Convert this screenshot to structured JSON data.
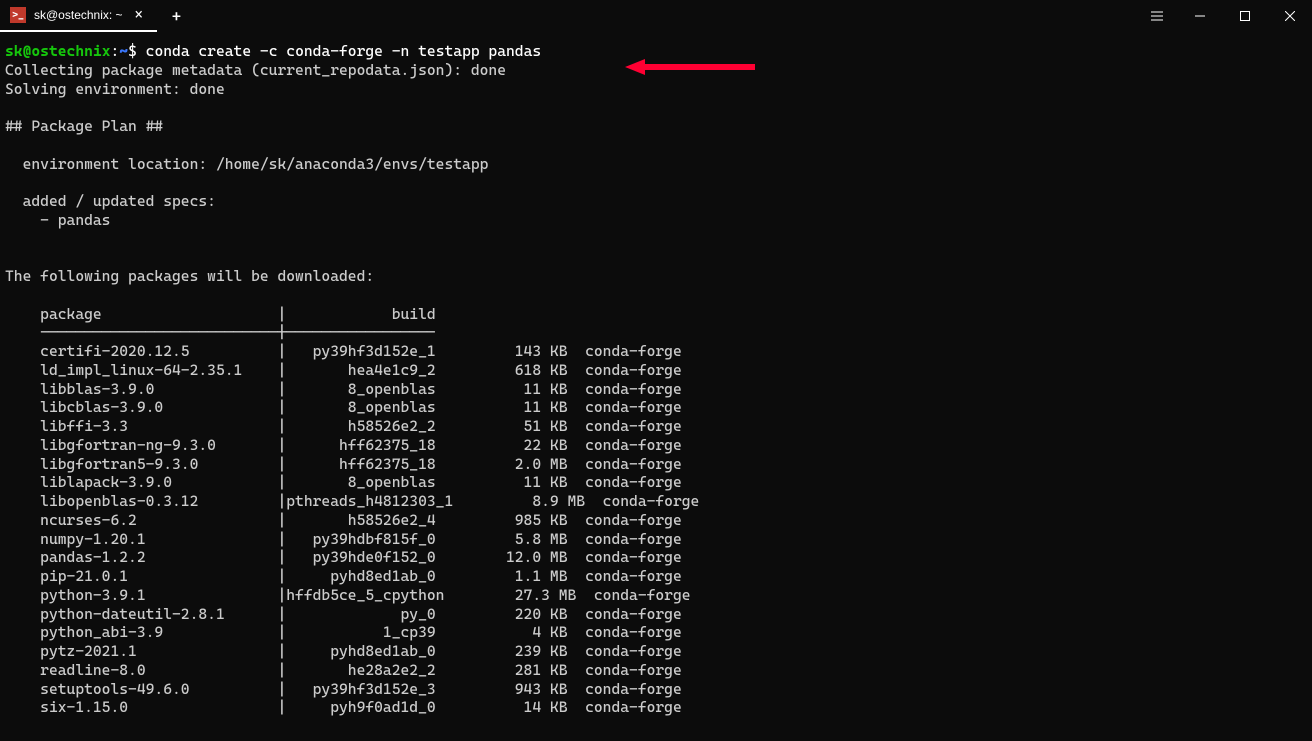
{
  "titlebar": {
    "tab_title": "sk@ostechnix: ~",
    "tab_icon_text": ">_"
  },
  "prompt": {
    "user": "sk",
    "at": "@",
    "host": "ostechnix",
    "colon": ":",
    "path": "~",
    "dollar": "$ "
  },
  "command": "conda create -c conda-forge -n testapp pandas",
  "output": {
    "line1": "Collecting package metadata (current_repodata.json): done",
    "line2": "Solving environment: done",
    "blank1": "",
    "plan_header": "## Package Plan ##",
    "blank2": "",
    "env_location": "  environment location: /home/sk/anaconda3/envs/testapp",
    "blank3": "",
    "added_specs": "  added / updated specs:",
    "specs_pandas": "    - pandas",
    "blank4": "",
    "blank5": "",
    "downloaded_header": "The following packages will be downloaded:",
    "blank6": "",
    "table_header": "    package                    |            build",
    "table_divider": "    ---------------------------|-----------------",
    "pkg_certifi": "    certifi-2020.12.5          |   py39hf3d152e_1         143 KB  conda-forge",
    "pkg_ld_impl": "    ld_impl_linux-64-2.35.1    |       hea4e1c9_2         618 KB  conda-forge",
    "pkg_libblas": "    libblas-3.9.0              |       8_openblas          11 KB  conda-forge",
    "pkg_libcblas": "    libcblas-3.9.0             |       8_openblas          11 KB  conda-forge",
    "pkg_libffi": "    libffi-3.3                 |       h58526e2_2          51 KB  conda-forge",
    "pkg_libgfortran_ng": "    libgfortran-ng-9.3.0       |      hff62375_18          22 KB  conda-forge",
    "pkg_libgfortran5": "    libgfortran5-9.3.0         |      hff62375_18         2.0 MB  conda-forge",
    "pkg_liblapack": "    liblapack-3.9.0            |       8_openblas          11 KB  conda-forge",
    "pkg_libopenblas": "    libopenblas-0.3.12         |pthreads_h4812303_1         8.9 MB  conda-forge",
    "pkg_ncurses": "    ncurses-6.2                |       h58526e2_4         985 KB  conda-forge",
    "pkg_numpy": "    numpy-1.20.1               |   py39hdbf815f_0         5.8 MB  conda-forge",
    "pkg_pandas": "    pandas-1.2.2               |   py39hde0f152_0        12.0 MB  conda-forge",
    "pkg_pip": "    pip-21.0.1                 |     pyhd8ed1ab_0         1.1 MB  conda-forge",
    "pkg_python": "    python-3.9.1               |hffdb5ce_5_cpython        27.3 MB  conda-forge",
    "pkg_python_dateutil": "    python-dateutil-2.8.1      |             py_0         220 KB  conda-forge",
    "pkg_python_abi": "    python_abi-3.9             |           1_cp39           4 KB  conda-forge",
    "pkg_pytz": "    pytz-2021.1                |     pyhd8ed1ab_0         239 KB  conda-forge",
    "pkg_readline": "    readline-8.0               |       he28a2e2_2         281 KB  conda-forge",
    "pkg_setuptools": "    setuptools-49.6.0          |   py39hf3d152e_3         943 KB  conda-forge",
    "pkg_six": "    six-1.15.0                 |     pyh9f0ad1d_0          14 KB  conda-forge"
  }
}
